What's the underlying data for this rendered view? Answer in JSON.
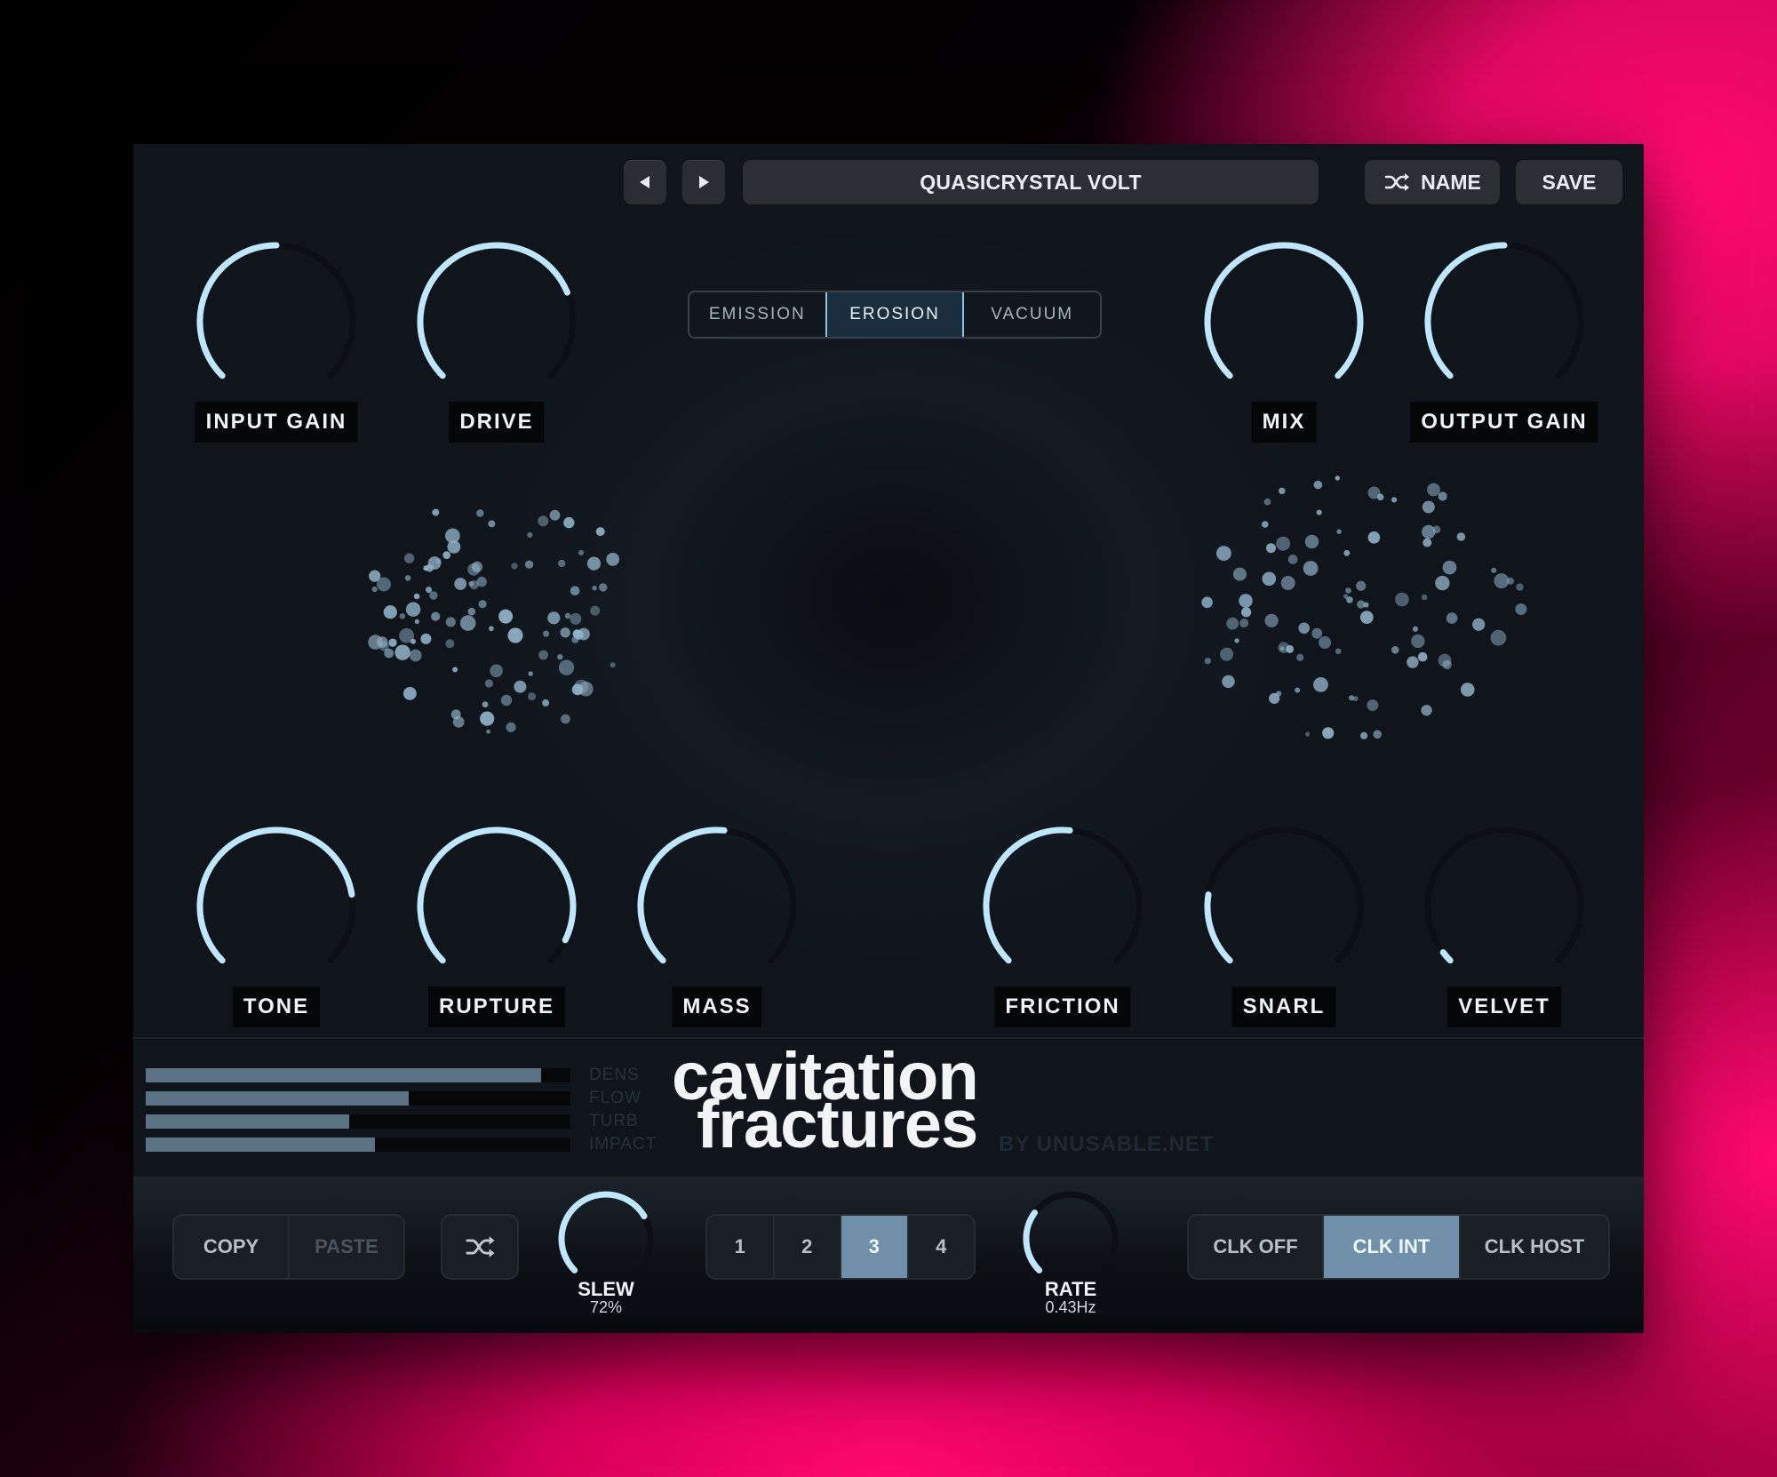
{
  "header": {
    "preset_name": "QUASICRYSTAL VOLT",
    "prev_icon": "triangle-left-icon",
    "next_icon": "triangle-right-icon",
    "name_label": "NAME",
    "name_icon": "shuffle-icon",
    "save_label": "SAVE"
  },
  "modes": {
    "items": [
      "EMISSION",
      "EROSION",
      "VACUUM"
    ],
    "selected": "EROSION"
  },
  "knobs": {
    "input_gain": {
      "label": "INPUT GAIN",
      "value": 0.5
    },
    "drive": {
      "label": "DRIVE",
      "value": 0.75
    },
    "mix": {
      "label": "MIX",
      "value": 1.0
    },
    "output_gain": {
      "label": "OUTPUT GAIN",
      "value": 0.5
    },
    "tone": {
      "label": "TONE",
      "value": 0.8
    },
    "rupture": {
      "label": "RUPTURE",
      "value": 0.93
    },
    "mass": {
      "label": "MASS",
      "value": 0.52
    },
    "friction": {
      "label": "FRICTION",
      "value": 0.52
    },
    "snarl": {
      "label": "SNARL",
      "value": 0.2
    },
    "velvet": {
      "label": "VELVET",
      "value": 0.03
    }
  },
  "meters": [
    {
      "label": "DENS",
      "value": 0.93
    },
    {
      "label": "FLOW",
      "value": 0.62
    },
    {
      "label": "TURB",
      "value": 0.48
    },
    {
      "label": "IMPACT",
      "value": 0.54
    }
  ],
  "brand": {
    "line1": "cavitation",
    "line2": "fractures",
    "by": "BY UNUSABLE.NET"
  },
  "bottom": {
    "copy_label": "COPY",
    "paste_label": "PASTE",
    "randomize_icon": "shuffle-icon",
    "slew": {
      "label": "SLEW",
      "value_text": "72%",
      "value": 0.72
    },
    "slots": [
      "1",
      "2",
      "3",
      "4"
    ],
    "selected_slot": "3",
    "rate": {
      "label": "RATE",
      "value_text": "0.43Hz",
      "value": 0.3
    },
    "clock": {
      "items": [
        "CLK OFF",
        "CLK INT",
        "CLK HOST"
      ],
      "selected": "CLK INT"
    }
  },
  "colors": {
    "accent": "#bfe6ff",
    "track": "#0c1014",
    "particle": "#8fb0c6",
    "background_pink": "#ff0a6e"
  }
}
